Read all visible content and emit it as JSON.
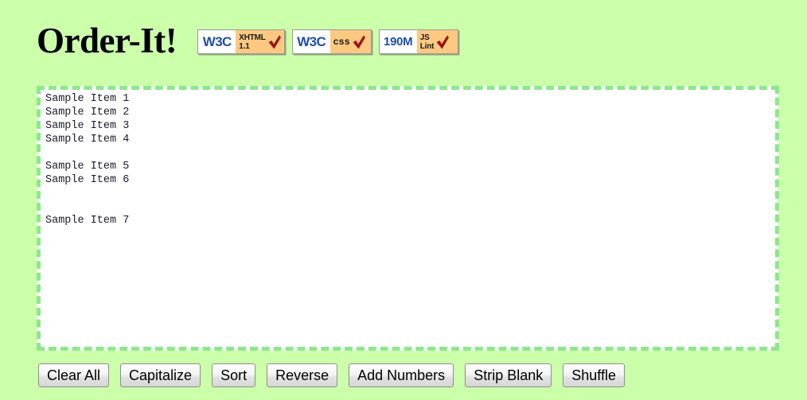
{
  "page": {
    "background_color": "#ccffaa",
    "title": "Order-It!"
  },
  "header": {
    "title": "Order-It!",
    "badges": [
      {
        "name": "xhtml-badge",
        "left_text": "W3C",
        "right_text": "XHTML\n1.1",
        "icon": "checkmark-icon",
        "accent_color": "#fdc981"
      },
      {
        "name": "css-badge",
        "left_text": "W3C",
        "right_text": "css",
        "icon": "checkmark-icon",
        "accent_color": "#fdc981"
      },
      {
        "name": "jslint-badge",
        "left_text": "190M",
        "right_text": "JS\nLint",
        "icon": "checkmark-icon",
        "accent_color": "#fdc981"
      }
    ]
  },
  "editor": {
    "value": "Sample Item 1\nSample Item 2\nSample Item 3\nSample Item 4\n\nSample Item 5\nSample Item 6\n\n\nSample Item 7",
    "placeholder": "",
    "border_color": "#8ce88c",
    "background_color": "#ffffff"
  },
  "toolbar": {
    "buttons": [
      {
        "id": "clear-all",
        "label": "Clear All"
      },
      {
        "id": "capitalize",
        "label": "Capitalize"
      },
      {
        "id": "sort",
        "label": "Sort"
      },
      {
        "id": "reverse",
        "label": "Reverse"
      },
      {
        "id": "add-numbers",
        "label": "Add Numbers"
      },
      {
        "id": "strip-blank",
        "label": "Strip Blank"
      },
      {
        "id": "shuffle",
        "label": "Shuffle"
      }
    ]
  }
}
